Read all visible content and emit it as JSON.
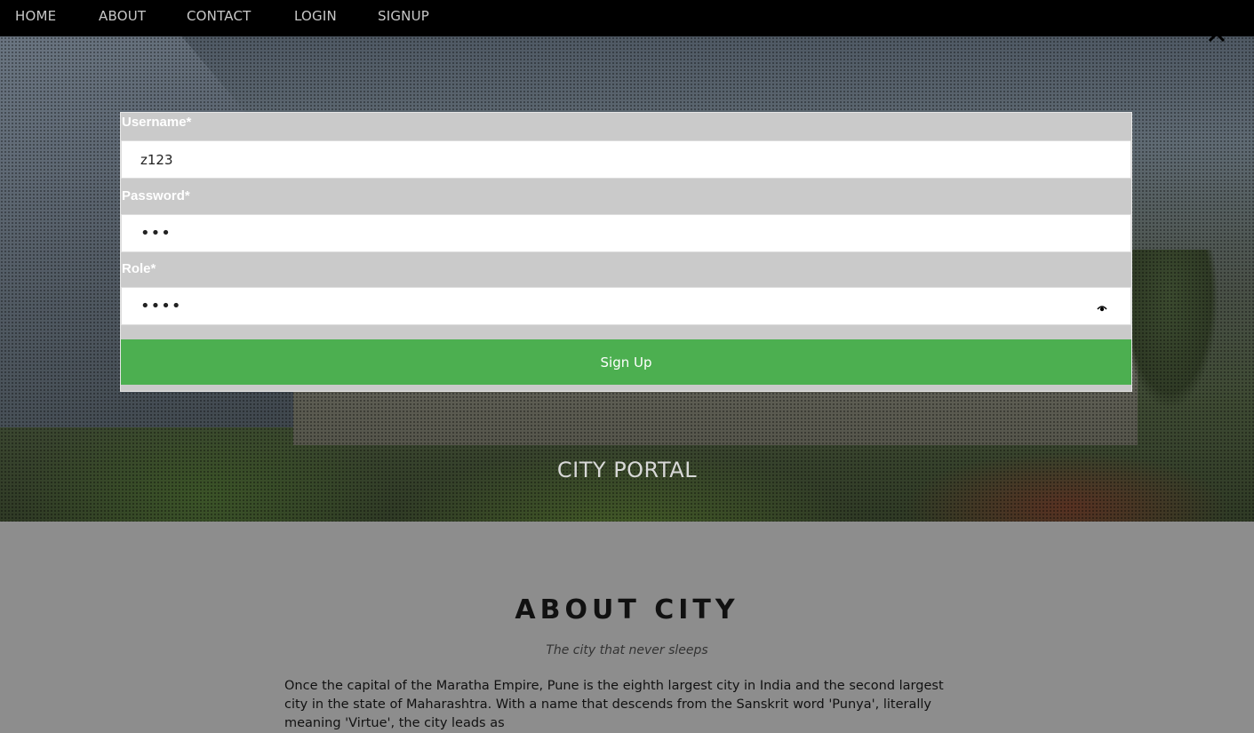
{
  "nav": {
    "items": [
      "HOME",
      "ABOUT",
      "CONTACT",
      "LOGIN",
      "SIGNUP"
    ]
  },
  "hero": {
    "title": "CITY PORTAL"
  },
  "form": {
    "username_label": "Username*",
    "username_value": "z123",
    "password_label": "Password*",
    "password_value": "•••",
    "role_label": "Role*",
    "role_value": "••••",
    "submit_label": "Sign Up"
  },
  "about": {
    "heading": "ABOUT CITY",
    "subtitle": "The city that never sleeps",
    "text": "Once the capital of the Maratha Empire, Pune is the eighth largest city in India and the second largest city in the state of Maharashtra. With a name that descends from the Sanskrit word 'Punya', literally meaning 'Virtue', the city leads as"
  },
  "colors": {
    "navbar": "#000000",
    "form_panel": "#cacaca",
    "signup_button": "#4caf50",
    "about_bg": "#8d8d8d"
  },
  "icons": {
    "close": "close-icon",
    "eye": "eye-icon"
  }
}
